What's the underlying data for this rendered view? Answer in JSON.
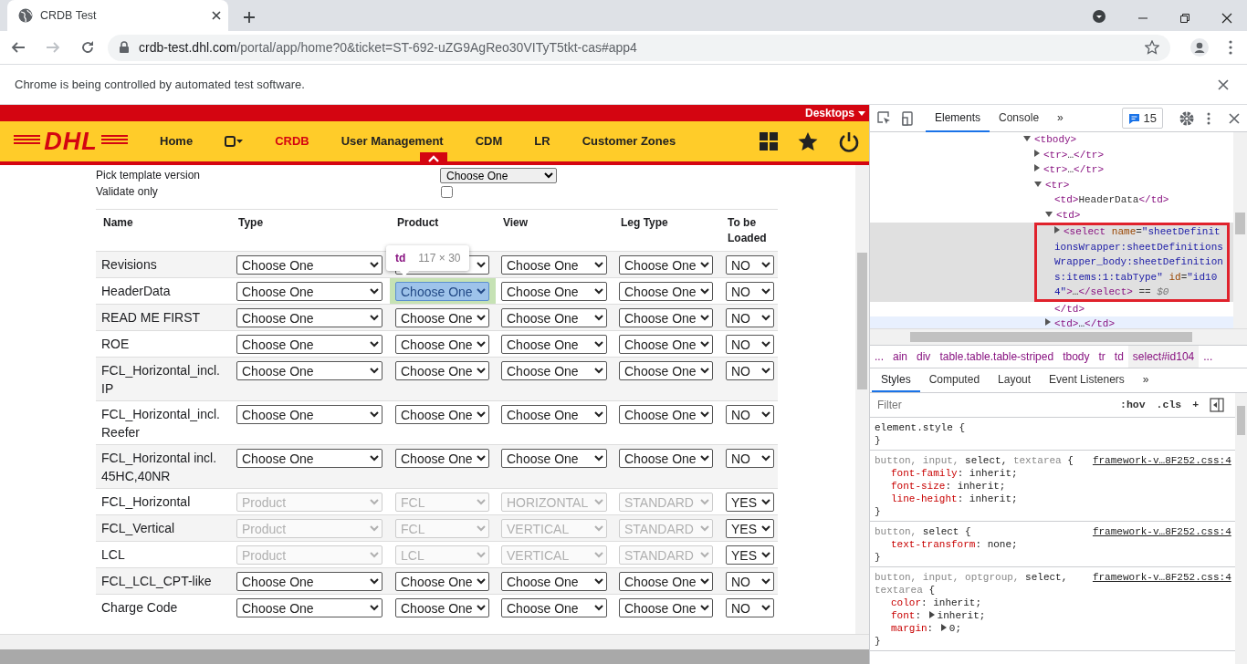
{
  "browser": {
    "tab": {
      "title": "CRDB Test"
    },
    "url": {
      "host": "crdb-test.dhl.com",
      "path": "/portal/app/home?0&ticket=ST-692-uZG9AgReo30VITyT5tkt-cas#app4"
    },
    "infobar": "Chrome is being controlled by automated test software."
  },
  "app": {
    "desktops": "Desktops",
    "logo": "DHL",
    "nav": [
      {
        "kind": "link",
        "label": "Home",
        "selected": false
      },
      {
        "kind": "icon-menu",
        "selected": false
      },
      {
        "kind": "link",
        "label": "CRDB",
        "selected": true
      },
      {
        "kind": "link",
        "label": "User Management",
        "selected": false
      },
      {
        "kind": "link",
        "label": "CDM",
        "selected": false
      },
      {
        "kind": "link",
        "label": "LR",
        "selected": false
      },
      {
        "kind": "link",
        "label": "Customer Zones",
        "selected": false
      }
    ]
  },
  "form": {
    "fields": [
      {
        "kind": "select",
        "label": "Pick template version",
        "value": "Choose One"
      },
      {
        "kind": "checkbox",
        "label": "Validate only",
        "checked": false
      }
    ]
  },
  "table": {
    "columns": [
      "Name",
      "Type",
      "Product",
      "View",
      "Leg Type",
      "To be Loaded"
    ],
    "inspect_tooltip": {
      "tag": "td",
      "size": "117 × 30"
    },
    "rows": [
      {
        "cells": [
          {
            "kind": "text",
            "value": "Revisions"
          },
          {
            "kind": "select",
            "value": "Choose One",
            "disabled": false,
            "inspected": false
          },
          {
            "kind": "select",
            "disabled": false,
            "inspected": false
          },
          {
            "kind": "select",
            "value": "Choose One",
            "disabled": false,
            "inspected": false
          },
          {
            "kind": "select",
            "value": "Choose One",
            "disabled": false,
            "inspected": false
          },
          {
            "kind": "select",
            "value": "NO",
            "disabled": false,
            "inspected": false
          }
        ]
      },
      {
        "cells": [
          {
            "kind": "text",
            "value": "HeaderData"
          },
          {
            "kind": "select",
            "value": "Choose One",
            "disabled": false,
            "inspected": false
          },
          {
            "kind": "select",
            "value": "Choose One",
            "disabled": false,
            "inspected": true
          },
          {
            "kind": "select",
            "value": "Choose One",
            "disabled": false,
            "inspected": false
          },
          {
            "kind": "select",
            "value": "Choose One",
            "disabled": false,
            "inspected": false
          },
          {
            "kind": "select",
            "value": "NO",
            "disabled": false,
            "inspected": false
          }
        ]
      },
      {
        "cells": [
          {
            "kind": "text",
            "value": "READ ME FIRST"
          },
          {
            "kind": "select",
            "value": "Choose One",
            "disabled": false,
            "inspected": false
          },
          {
            "kind": "select",
            "value": "Choose One",
            "disabled": false,
            "inspected": false
          },
          {
            "kind": "select",
            "value": "Choose One",
            "disabled": false,
            "inspected": false
          },
          {
            "kind": "select",
            "value": "Choose One",
            "disabled": false,
            "inspected": false
          },
          {
            "kind": "select",
            "value": "NO",
            "disabled": false,
            "inspected": false
          }
        ]
      },
      {
        "cells": [
          {
            "kind": "text",
            "value": "ROE"
          },
          {
            "kind": "select",
            "value": "Choose One",
            "disabled": false,
            "inspected": false
          },
          {
            "kind": "select",
            "value": "Choose One",
            "disabled": false,
            "inspected": false
          },
          {
            "kind": "select",
            "value": "Choose One",
            "disabled": false,
            "inspected": false
          },
          {
            "kind": "select",
            "value": "Choose One",
            "disabled": false,
            "inspected": false
          },
          {
            "kind": "select",
            "value": "NO",
            "disabled": false,
            "inspected": false
          }
        ]
      },
      {
        "cells": [
          {
            "kind": "text",
            "value": "FCL_Horizontal_incl. IP"
          },
          {
            "kind": "select",
            "value": "Choose One",
            "disabled": false,
            "inspected": false
          },
          {
            "kind": "select",
            "value": "Choose One",
            "disabled": false,
            "inspected": false
          },
          {
            "kind": "select",
            "value": "Choose One",
            "disabled": false,
            "inspected": false
          },
          {
            "kind": "select",
            "value": "Choose One",
            "disabled": false,
            "inspected": false
          },
          {
            "kind": "select",
            "value": "NO",
            "disabled": false,
            "inspected": false
          }
        ]
      },
      {
        "cells": [
          {
            "kind": "text",
            "value": "FCL_Horizontal_incl. Reefer"
          },
          {
            "kind": "select",
            "value": "Choose One",
            "disabled": false,
            "inspected": false
          },
          {
            "kind": "select",
            "value": "Choose One",
            "disabled": false,
            "inspected": false
          },
          {
            "kind": "select",
            "value": "Choose One",
            "disabled": false,
            "inspected": false
          },
          {
            "kind": "select",
            "value": "Choose One",
            "disabled": false,
            "inspected": false
          },
          {
            "kind": "select",
            "value": "NO",
            "disabled": false,
            "inspected": false
          }
        ]
      },
      {
        "cells": [
          {
            "kind": "text",
            "value": "FCL_Horizontal incl. 45HC,40NR"
          },
          {
            "kind": "select",
            "value": "Choose One",
            "disabled": false,
            "inspected": false
          },
          {
            "kind": "select",
            "value": "Choose One",
            "disabled": false,
            "inspected": false
          },
          {
            "kind": "select",
            "value": "Choose One",
            "disabled": false,
            "inspected": false
          },
          {
            "kind": "select",
            "value": "Choose One",
            "disabled": false,
            "inspected": false
          },
          {
            "kind": "select",
            "value": "NO",
            "disabled": false,
            "inspected": false
          }
        ]
      },
      {
        "cells": [
          {
            "kind": "text",
            "value": "FCL_Horizontal"
          },
          {
            "kind": "select",
            "value": "Product",
            "disabled": true,
            "inspected": false
          },
          {
            "kind": "select",
            "value": "FCL",
            "disabled": true,
            "inspected": false
          },
          {
            "kind": "select",
            "value": "HORIZONTAL",
            "disabled": true,
            "inspected": false
          },
          {
            "kind": "select",
            "value": "STANDARD",
            "disabled": true,
            "inspected": false
          },
          {
            "kind": "select",
            "value": "YES",
            "disabled": false,
            "inspected": false
          }
        ]
      },
      {
        "cells": [
          {
            "kind": "text",
            "value": "FCL_Vertical"
          },
          {
            "kind": "select",
            "value": "Product",
            "disabled": true,
            "inspected": false
          },
          {
            "kind": "select",
            "value": "FCL",
            "disabled": true,
            "inspected": false
          },
          {
            "kind": "select",
            "value": "VERTICAL",
            "disabled": true,
            "inspected": false
          },
          {
            "kind": "select",
            "value": "STANDARD",
            "disabled": true,
            "inspected": false
          },
          {
            "kind": "select",
            "value": "YES",
            "disabled": false,
            "inspected": false
          }
        ]
      },
      {
        "cells": [
          {
            "kind": "text",
            "value": "LCL"
          },
          {
            "kind": "select",
            "value": "Product",
            "disabled": true,
            "inspected": false
          },
          {
            "kind": "select",
            "value": "LCL",
            "disabled": true,
            "inspected": false
          },
          {
            "kind": "select",
            "value": "VERTICAL",
            "disabled": true,
            "inspected": false
          },
          {
            "kind": "select",
            "value": "STANDARD",
            "disabled": true,
            "inspected": false
          },
          {
            "kind": "select",
            "value": "YES",
            "disabled": false,
            "inspected": false
          }
        ]
      },
      {
        "cells": [
          {
            "kind": "text",
            "value": "FCL_LCL_CPT-like"
          },
          {
            "kind": "select",
            "value": "Choose One",
            "disabled": false,
            "inspected": false
          },
          {
            "kind": "select",
            "value": "Choose One",
            "disabled": false,
            "inspected": false
          },
          {
            "kind": "select",
            "value": "Choose One",
            "disabled": false,
            "inspected": false
          },
          {
            "kind": "select",
            "value": "Choose One",
            "disabled": false,
            "inspected": false
          },
          {
            "kind": "select",
            "value": "NO",
            "disabled": false,
            "inspected": false
          }
        ]
      },
      {
        "cells": [
          {
            "kind": "text",
            "value": "Charge Code"
          },
          {
            "kind": "select",
            "value": "Choose One",
            "disabled": false,
            "inspected": false
          },
          {
            "kind": "select",
            "value": "Choose One",
            "disabled": false,
            "inspected": false
          },
          {
            "kind": "select",
            "value": "Choose One",
            "disabled": false,
            "inspected": false
          },
          {
            "kind": "select",
            "value": "Choose One",
            "disabled": false,
            "inspected": false
          },
          {
            "kind": "select",
            "value": "NO",
            "disabled": false,
            "inspected": false
          }
        ]
      }
    ]
  },
  "devtools": {
    "tabs": [
      {
        "label": "Elements",
        "selected": true
      },
      {
        "label": "Console",
        "selected": false
      }
    ],
    "more": "»",
    "issues": "15",
    "annotation_box": true,
    "dom": [
      {
        "text": "<tbody>",
        "expanded": true,
        "selected": false,
        "hovered": false,
        "children": [
          {
            "text": "<tr>…</tr>",
            "expanded": false,
            "selected": false,
            "hovered": false
          },
          {
            "text": "<tr>…</tr>",
            "expanded": false,
            "selected": false,
            "hovered": false
          },
          {
            "text": "<tr>",
            "expanded": true,
            "selected": false,
            "hovered": false,
            "children": [
              {
                "text": "<td>HeaderData</td>",
                "selected": false,
                "hovered": false
              },
              {
                "text": "<td>",
                "expanded": true,
                "selected": false,
                "hovered": false,
                "closing": "</td>",
                "children": [
                  {
                    "text": "<select name=\"sheetDefinitionsWrapper:sheetDefinitionsWrapper_body:sheetDefinitions:items:1:tabType\" id=\"id104\">…</select> == $0",
                    "expanded": false,
                    "selected": true,
                    "hovered": false
                  }
                ]
              },
              {
                "text": "<td>…</td>",
                "expanded": false,
                "selected": false,
                "hovered": true
              }
            ]
          }
        ]
      }
    ],
    "breadcrumbs": [
      {
        "label": "...",
        "selected": false
      },
      {
        "label": "ain",
        "selected": false
      },
      {
        "label": "div",
        "selected": false
      },
      {
        "label": "table.table.table-striped",
        "selected": false
      },
      {
        "label": "tbody",
        "selected": false
      },
      {
        "label": "tr",
        "selected": false
      },
      {
        "label": "td",
        "selected": false
      },
      {
        "label": "select#id104",
        "selected": true
      },
      {
        "label": "...",
        "selected": false
      }
    ],
    "style_tabs": [
      {
        "label": "Styles",
        "selected": true
      },
      {
        "label": "Computed",
        "selected": false
      },
      {
        "label": "Layout",
        "selected": false
      },
      {
        "label": "Event Listeners",
        "selected": false
      }
    ],
    "style_more": "»",
    "filter": {
      "placeholder": "Filter",
      "buttons": [
        ":hov",
        ".cls",
        "+"
      ]
    },
    "rules": [
      {
        "selectors": [
          {
            "text": "element.style",
            "matched": true
          }
        ],
        "open": "{",
        "close": "}"
      },
      {
        "selectors": [
          {
            "text": "button,",
            "matched": false
          },
          {
            "text": "input,",
            "matched": false
          },
          {
            "text": "select,",
            "matched": true
          },
          {
            "text": "textarea",
            "matched": false
          }
        ],
        "open": "{",
        "source": "framework-v…8F252.css:4",
        "declarations": [
          {
            "text": "font-family: inherit;",
            "expandable": false
          },
          {
            "text": "font-size: inherit;",
            "expandable": false
          },
          {
            "text": "line-height: inherit;",
            "expandable": false
          }
        ],
        "close": "}"
      },
      {
        "selectors": [
          {
            "text": "button,",
            "matched": false
          },
          {
            "text": "select",
            "matched": true
          }
        ],
        "open": "{",
        "source": "framework-v…8F252.css:4",
        "declarations": [
          {
            "text": "text-transform: none;",
            "expandable": false
          }
        ],
        "close": "}"
      },
      {
        "selectors": [
          {
            "text": "button,",
            "matched": false
          },
          {
            "text": "input,",
            "matched": false
          },
          {
            "text": "optgroup,",
            "matched": false
          },
          {
            "text": "select,",
            "matched": true
          },
          {
            "text": "textarea",
            "matched": false
          }
        ],
        "open": "{",
        "source": "framework-v…8F252.css:4",
        "declarations": [
          {
            "text": "color: inherit;",
            "expandable": false
          },
          {
            "text": "font: inherit;",
            "expandable": true
          },
          {
            "text": "margin: 0;",
            "expandable": true
          }
        ],
        "close": "}"
      }
    ]
  }
}
